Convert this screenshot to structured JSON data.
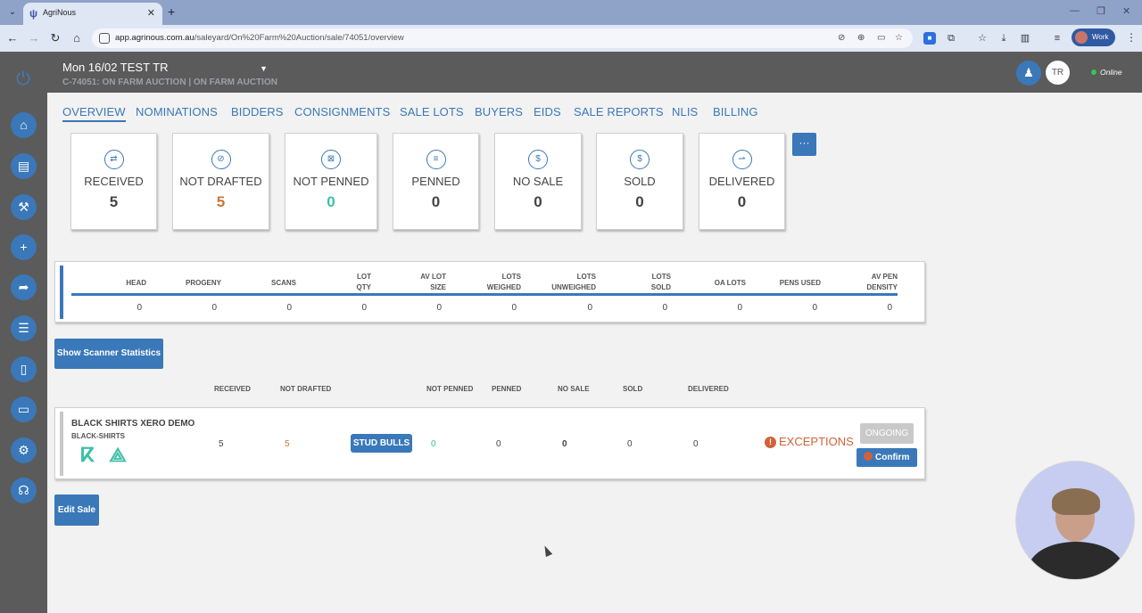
{
  "browser": {
    "tab_title": "AgriNous",
    "url_domain": "app.agrinous.com.au",
    "url_path": "/saleyard/On%20Farm%20Auction/sale/74051/overview",
    "profile_label": "Work"
  },
  "header": {
    "sale_title": "Mon 16/02 TEST TR",
    "sale_subtitle": "C-74051: ON FARM AUCTION | ON FARM AUCTION",
    "avatar_initials": "TR",
    "status": "Online",
    "status_color": "#39c45a"
  },
  "nav_tabs": [
    "OVERVIEW",
    "NOMINATIONS",
    "BIDDERS",
    "CONSIGNMENTS",
    "SALE LOTS",
    "BUYERS",
    "EIDS",
    "SALE REPORTS",
    "NLIS",
    "BILLING"
  ],
  "status_cards": [
    {
      "label": "RECEIVED",
      "value": "5",
      "icon": "received-icon"
    },
    {
      "label": "NOT DRAFTED",
      "value": "5",
      "icon": "not-drafted-icon"
    },
    {
      "label": "NOT PENNED",
      "value": "0",
      "icon": "not-penned-icon"
    },
    {
      "label": "PENNED",
      "value": "0",
      "icon": "penned-icon"
    },
    {
      "label": "NO SALE",
      "value": "0",
      "icon": "no-sale-icon"
    },
    {
      "label": "SOLD",
      "value": "0",
      "icon": "dollar-icon"
    },
    {
      "label": "DELIVERED",
      "value": "0",
      "icon": "delivered-icon"
    }
  ],
  "more_button": "···",
  "stats": {
    "headers": [
      [
        "HEAD"
      ],
      [
        "PROGENY"
      ],
      [
        "SCANS"
      ],
      [
        "LOT",
        "QTY"
      ],
      [
        "AV LOT",
        "SIZE"
      ],
      [
        "LOTS",
        "WEIGHED"
      ],
      [
        "LOTS",
        "UNWEIGHED"
      ],
      [
        "LOTS",
        "SOLD"
      ],
      [
        "OA LOTS"
      ],
      [
        "PENS USED"
      ],
      [
        "AV PEN",
        "DENSITY"
      ]
    ],
    "values": [
      "0",
      "0",
      "0",
      "0",
      "0",
      "0",
      "0",
      "0",
      "0",
      "0",
      "0"
    ]
  },
  "scanner_button": "Show Scanner Statistics",
  "vendor_columns": [
    "RECEIVED",
    "NOT DRAFTED",
    "NOT PENNED",
    "PENNED",
    "NO SALE",
    "SOLD",
    "DELIVERED"
  ],
  "vendor": {
    "name": "BLACK SHIRTS XERO DEMO",
    "code": "BLACK-SHIRTS",
    "received": "5",
    "not_drafted": "5",
    "badge": "STUD BULLS",
    "not_penned": "0",
    "penned": "0",
    "no_sale": "0",
    "sold": "0",
    "delivered": "0",
    "exceptions": "EXCEPTIONS",
    "ongoing": "ONGOING",
    "confirm": "Confirm"
  },
  "edit_button": "Edit Sale",
  "colors": {
    "accent": "#3a78b9",
    "warning": "#d0623a",
    "positive": "#3dbfa6",
    "not_drafted_value": "#c8753c"
  }
}
